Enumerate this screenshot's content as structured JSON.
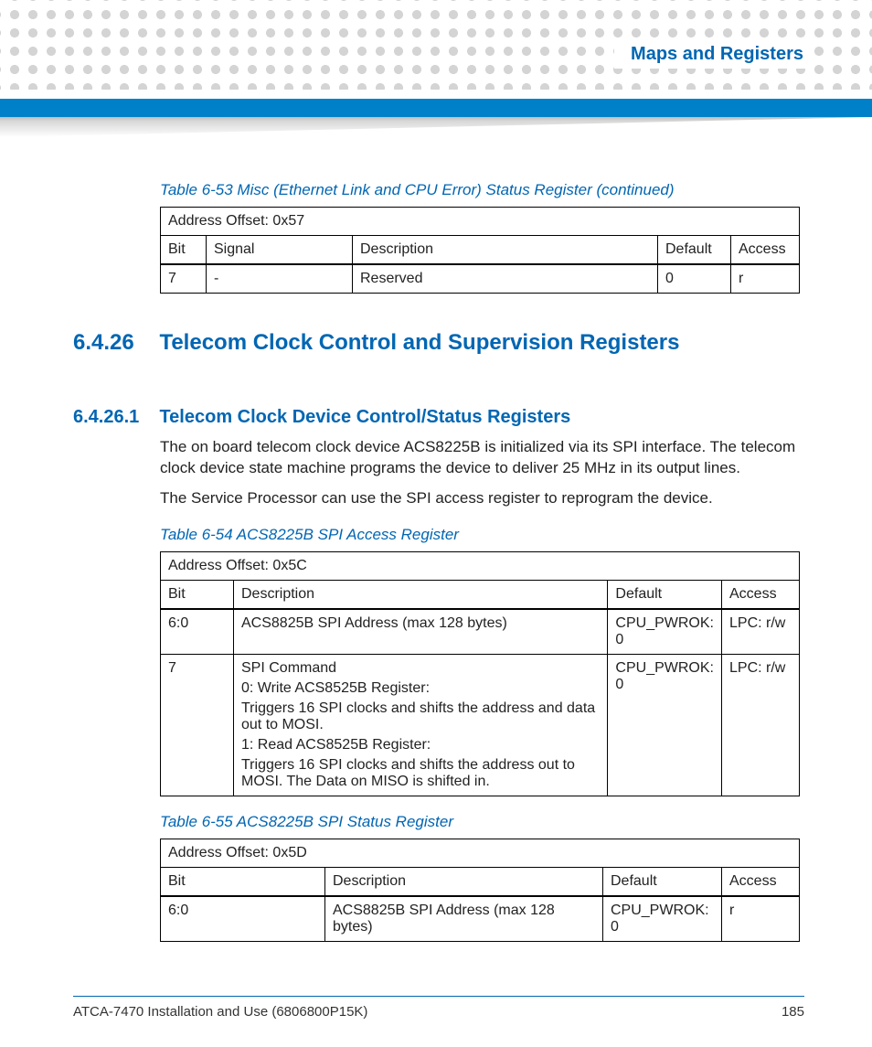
{
  "header": {
    "chapter_title": "Maps and Registers"
  },
  "table53": {
    "caption": "Table 6-53 Misc (Ethernet Link and CPU Error) Status Register (continued)",
    "offset": "Address Offset: 0x57",
    "cols": {
      "bit": "Bit",
      "signal": "Signal",
      "desc": "Description",
      "def": "Default",
      "acc": "Access"
    },
    "rows": [
      {
        "bit": "7",
        "signal": "-",
        "desc": "Reserved",
        "def": "0",
        "acc": "r"
      }
    ]
  },
  "section": {
    "num": "6.4.26",
    "title": "Telecom Clock Control and Supervision Registers"
  },
  "subsection": {
    "num": "6.4.26.1",
    "title": "Telecom Clock Device Control/Status Registers",
    "para1": "The on board telecom clock device ACS8225B is initialized via its SPI interface. The telecom clock device state machine programs the device to deliver 25 MHz in its output lines.",
    "para2": "The Service Processor can use the SPI access register to reprogram the device."
  },
  "table54": {
    "caption": "Table 6-54 ACS8225B SPI Access Register",
    "offset": "Address Offset: 0x5C",
    "cols": {
      "bit": "Bit",
      "desc": "Description",
      "def": "Default",
      "acc": "Access"
    },
    "rows": [
      {
        "bit": "6:0",
        "desc_lines": [
          "ACS8825B SPI Address (max 128 bytes)"
        ],
        "def": "CPU_PWROK: 0",
        "acc": "LPC: r/w"
      },
      {
        "bit": "7",
        "desc_lines": [
          "SPI Command",
          "0: Write ACS8525B Register:",
          "Triggers 16 SPI clocks and shifts the address and data out to MOSI.",
          "1: Read ACS8525B Register:",
          "Triggers 16 SPI clocks and shifts the address out to MOSI. The Data on MISO is shifted in."
        ],
        "def": "CPU_PWROK: 0",
        "acc": "LPC: r/w"
      }
    ]
  },
  "table55": {
    "caption": "Table 6-55 ACS8225B SPI Status Register",
    "offset": "Address Offset: 0x5D",
    "cols": {
      "bit": "Bit",
      "desc": "Description",
      "def": "Default",
      "acc": "Access"
    },
    "rows": [
      {
        "bit": "6:0",
        "desc": "ACS8825B SPI Address (max 128 bytes)",
        "def": "CPU_PWROK: 0",
        "acc": "r"
      }
    ]
  },
  "footer": {
    "doc": "ATCA-7470 Installation and Use (6806800P15K)",
    "page": "185"
  }
}
